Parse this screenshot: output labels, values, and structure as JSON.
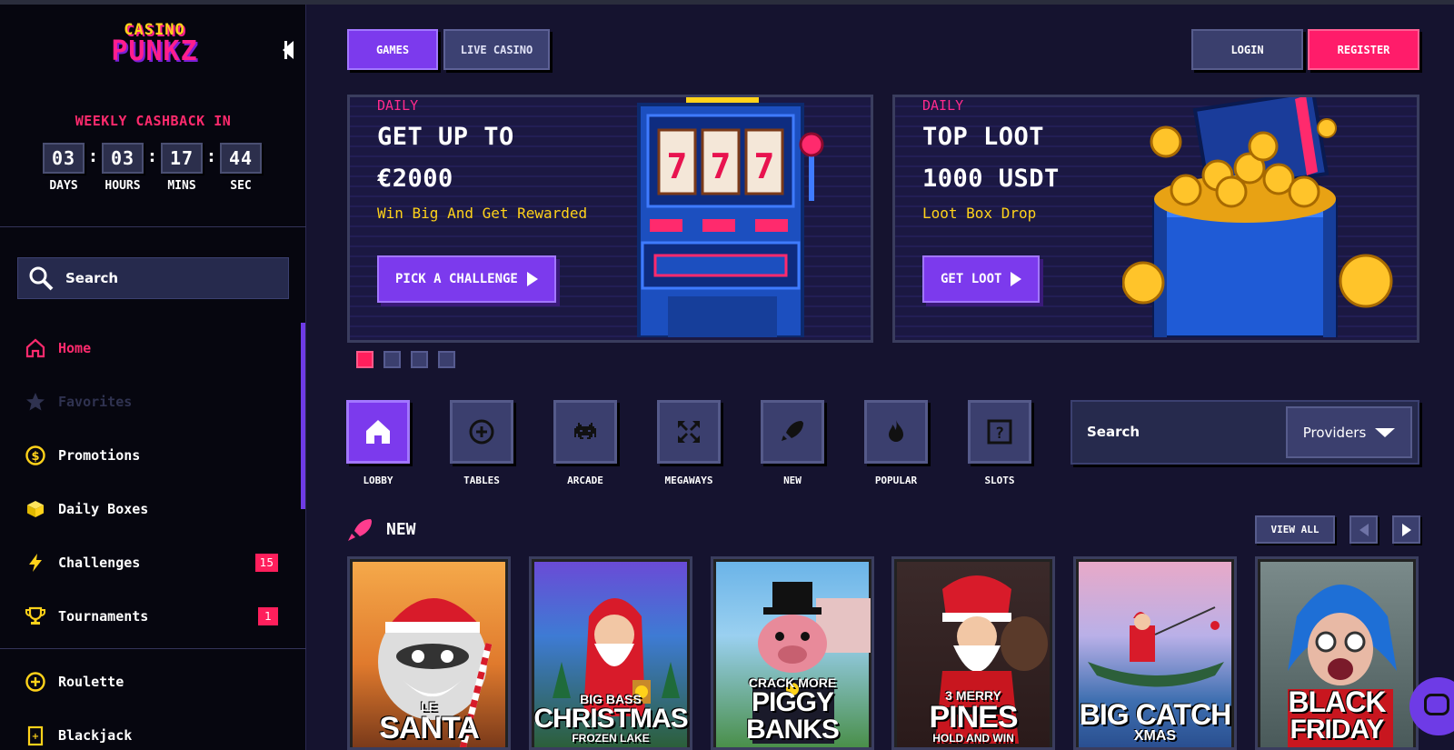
{
  "brand": {
    "line1": "CASINO",
    "line2": "PUNKZ"
  },
  "cashback": {
    "title": "WEEKLY CASHBACK IN",
    "days": "03",
    "hours": "03",
    "mins": "17",
    "sec": "44",
    "days_label": "DAYS",
    "hours_label": "HOURS",
    "mins_label": "MINS",
    "sec_label": "SEC"
  },
  "sidebar": {
    "search_label": "Search",
    "items": [
      {
        "label": "Home",
        "icon": "home-icon"
      },
      {
        "label": "Favorites",
        "icon": "star-icon"
      },
      {
        "label": "Promotions",
        "icon": "dollar-coin-icon"
      },
      {
        "label": "Daily Boxes",
        "icon": "box-icon"
      },
      {
        "label": "Challenges",
        "icon": "lightning-icon",
        "badge": "15"
      },
      {
        "label": "Tournaments",
        "icon": "trophy-icon",
        "badge": "1"
      },
      {
        "label": "Roulette",
        "icon": "roulette-icon"
      },
      {
        "label": "Blackjack",
        "icon": "blackjack-icon"
      }
    ]
  },
  "header": {
    "tabs": [
      {
        "label": "GAMES"
      },
      {
        "label": "LIVE CASINO"
      }
    ],
    "login_label": "LOGIN",
    "register_label": "REGISTER"
  },
  "banners": [
    {
      "tag": "DAILY",
      "title1": "GET UP TO",
      "title2": "€2000",
      "subtitle": "Win Big And Get Rewarded",
      "cta": "PICK A CHALLENGE"
    },
    {
      "tag": "DAILY",
      "title1": "TOP LOOT",
      "title2": "1000 USDT",
      "subtitle": "Loot Box Drop",
      "cta": "GET LOOT"
    }
  ],
  "carousel": {
    "active_index": 0,
    "count": 4
  },
  "categories": [
    {
      "label": "LOBBY",
      "icon": "house-icon"
    },
    {
      "label": "TABLES",
      "icon": "chip-icon"
    },
    {
      "label": "ARCADE",
      "icon": "space-invader-icon"
    },
    {
      "label": "MEGAWAYS",
      "icon": "expand-arrows-icon"
    },
    {
      "label": "NEW",
      "icon": "rocket-icon"
    },
    {
      "label": "POPULAR",
      "icon": "flame-icon"
    },
    {
      "label": "SLOTS",
      "icon": "slot-question-icon"
    }
  ],
  "game_search": {
    "label": "Search",
    "providers_label": "Providers"
  },
  "new_section": {
    "title": "NEW",
    "view_all": "VIEW ALL",
    "games": [
      {
        "top": "LE",
        "main": "SANTA",
        "sub": ""
      },
      {
        "top": "BIG BASS",
        "main": "CHRISTMAS",
        "sub": "FROZEN LAKE"
      },
      {
        "top": "CRACK MORE",
        "main": "PIGGY BANKS",
        "sub": ""
      },
      {
        "top": "3 MERRY",
        "main": "PINES",
        "sub": "HOLD AND WIN"
      },
      {
        "top": "",
        "main": "BIG CATCH",
        "sub": "XMAS"
      },
      {
        "top": "",
        "main": "BLACK",
        "sub": "FRIDAY"
      }
    ]
  },
  "colors": {
    "accent": "#7c3aed",
    "pink": "#ff1c6a",
    "gold": "#ffd21a",
    "bg": "#15132f",
    "sidebar": "#06060f"
  }
}
